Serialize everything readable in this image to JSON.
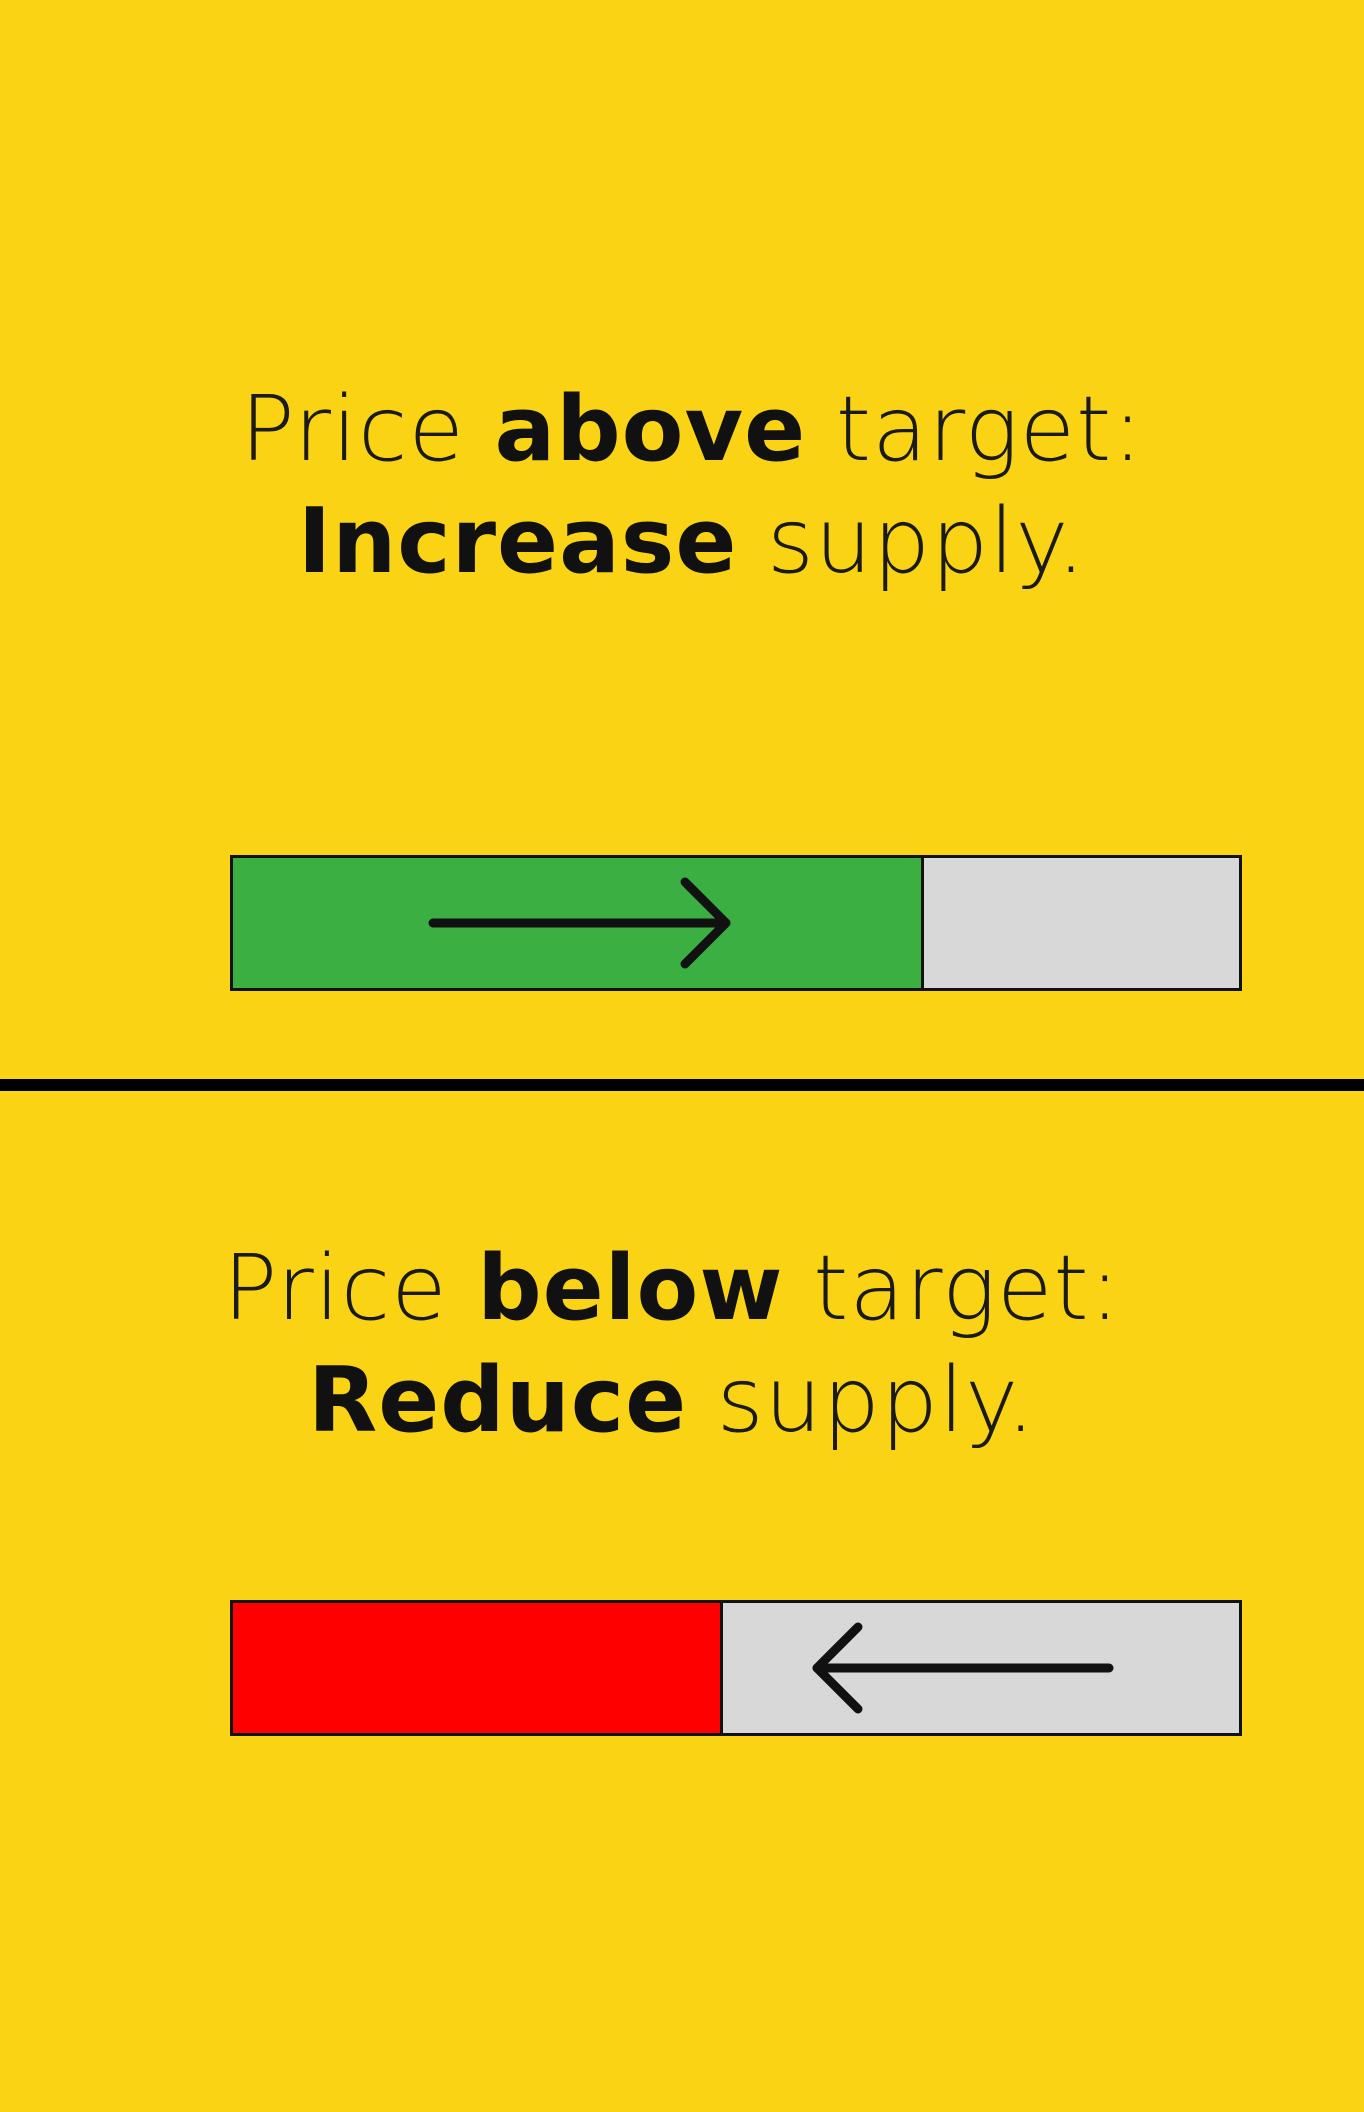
{
  "colors": {
    "background": "#FAD414",
    "increase_fill": "#3BAF41",
    "reduce_fill": "#FF0000",
    "empty": "#D8D8D8",
    "ink": "#111111"
  },
  "panels": [
    {
      "caption": {
        "line1_pre": "Price ",
        "line1_bold": "above",
        "line1_post": " target:",
        "line2_bold": "Increase",
        "line2_post": " supply."
      },
      "bar": {
        "fill_fraction": 0.687,
        "fill_color": "#3BAF41",
        "arrow_icon": "right-arrow-icon"
      }
    },
    {
      "caption": {
        "line1_pre": "Price ",
        "line1_bold": "below",
        "line1_post": " target:",
        "line2_bold": "Reduce",
        "line2_post": " supply."
      },
      "bar": {
        "fill_fraction": 0.487,
        "fill_color": "#FF0000",
        "arrow_icon": "left-arrow-icon"
      }
    }
  ]
}
